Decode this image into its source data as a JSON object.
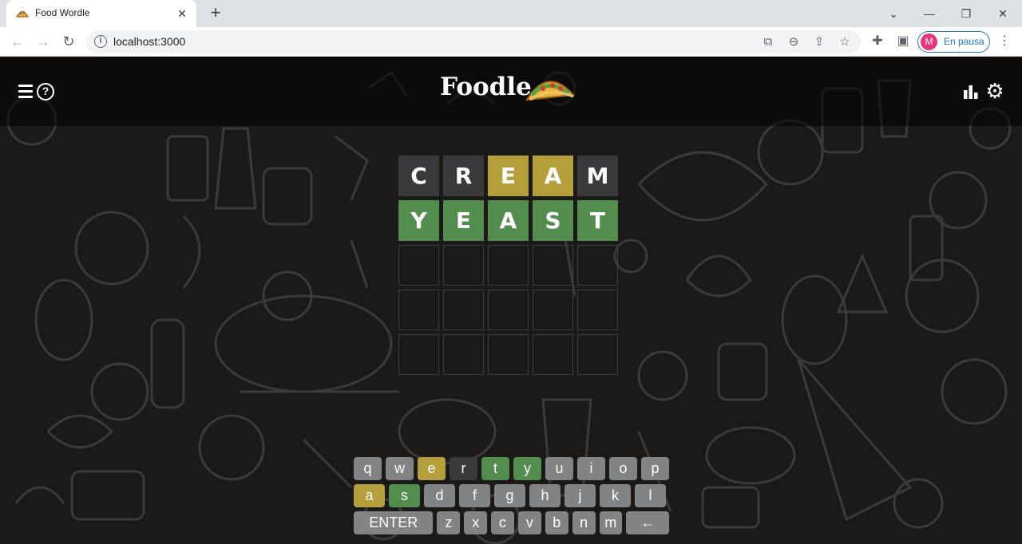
{
  "browser": {
    "tab_title": "Food Wordle",
    "tab_icon": "taco",
    "url": "localhost:3000",
    "profile_initial": "M",
    "profile_label": "En pausa"
  },
  "app": {
    "title": "Foodle",
    "colors": {
      "absent": "#3a3a3c",
      "present": "#b59f3b",
      "correct": "#538d4e",
      "unused": "#818384"
    }
  },
  "board": {
    "rows": [
      {
        "tiles": [
          {
            "letter": "C",
            "state": "absent"
          },
          {
            "letter": "R",
            "state": "absent"
          },
          {
            "letter": "E",
            "state": "present"
          },
          {
            "letter": "A",
            "state": "present"
          },
          {
            "letter": "M",
            "state": "absent"
          }
        ]
      },
      {
        "tiles": [
          {
            "letter": "Y",
            "state": "correct"
          },
          {
            "letter": "E",
            "state": "correct"
          },
          {
            "letter": "A",
            "state": "correct"
          },
          {
            "letter": "S",
            "state": "correct"
          },
          {
            "letter": "T",
            "state": "correct"
          }
        ]
      },
      {
        "tiles": [
          {
            "letter": "",
            "state": "empty"
          },
          {
            "letter": "",
            "state": "empty"
          },
          {
            "letter": "",
            "state": "empty"
          },
          {
            "letter": "",
            "state": "empty"
          },
          {
            "letter": "",
            "state": "empty"
          }
        ]
      },
      {
        "tiles": [
          {
            "letter": "",
            "state": "empty"
          },
          {
            "letter": "",
            "state": "empty"
          },
          {
            "letter": "",
            "state": "empty"
          },
          {
            "letter": "",
            "state": "empty"
          },
          {
            "letter": "",
            "state": "empty"
          }
        ]
      },
      {
        "tiles": [
          {
            "letter": "",
            "state": "empty"
          },
          {
            "letter": "",
            "state": "empty"
          },
          {
            "letter": "",
            "state": "empty"
          },
          {
            "letter": "",
            "state": "empty"
          },
          {
            "letter": "",
            "state": "empty"
          }
        ]
      }
    ]
  },
  "keyboard": {
    "rows": [
      [
        {
          "label": "q",
          "state": "unused"
        },
        {
          "label": "w",
          "state": "unused"
        },
        {
          "label": "e",
          "state": "present"
        },
        {
          "label": "r",
          "state": "absent"
        },
        {
          "label": "t",
          "state": "correct"
        },
        {
          "label": "y",
          "state": "correct"
        },
        {
          "label": "u",
          "state": "unused"
        },
        {
          "label": "i",
          "state": "unused"
        },
        {
          "label": "o",
          "state": "unused"
        },
        {
          "label": "p",
          "state": "unused"
        }
      ],
      [
        {
          "label": "a",
          "state": "present"
        },
        {
          "label": "s",
          "state": "correct"
        },
        {
          "label": "d",
          "state": "unused"
        },
        {
          "label": "f",
          "state": "unused"
        },
        {
          "label": "g",
          "state": "unused"
        },
        {
          "label": "h",
          "state": "unused"
        },
        {
          "label": "j",
          "state": "unused"
        },
        {
          "label": "k",
          "state": "unused"
        },
        {
          "label": "l",
          "state": "unused"
        }
      ],
      [
        {
          "label": "ENTER",
          "state": "unused"
        },
        {
          "label": "z",
          "state": "unused"
        },
        {
          "label": "x",
          "state": "unused"
        },
        {
          "label": "c",
          "state": "unused"
        },
        {
          "label": "v",
          "state": "unused"
        },
        {
          "label": "b",
          "state": "unused"
        },
        {
          "label": "n",
          "state": "unused"
        },
        {
          "label": "m",
          "state": "unused"
        },
        {
          "label": "←",
          "state": "unused"
        }
      ]
    ]
  }
}
